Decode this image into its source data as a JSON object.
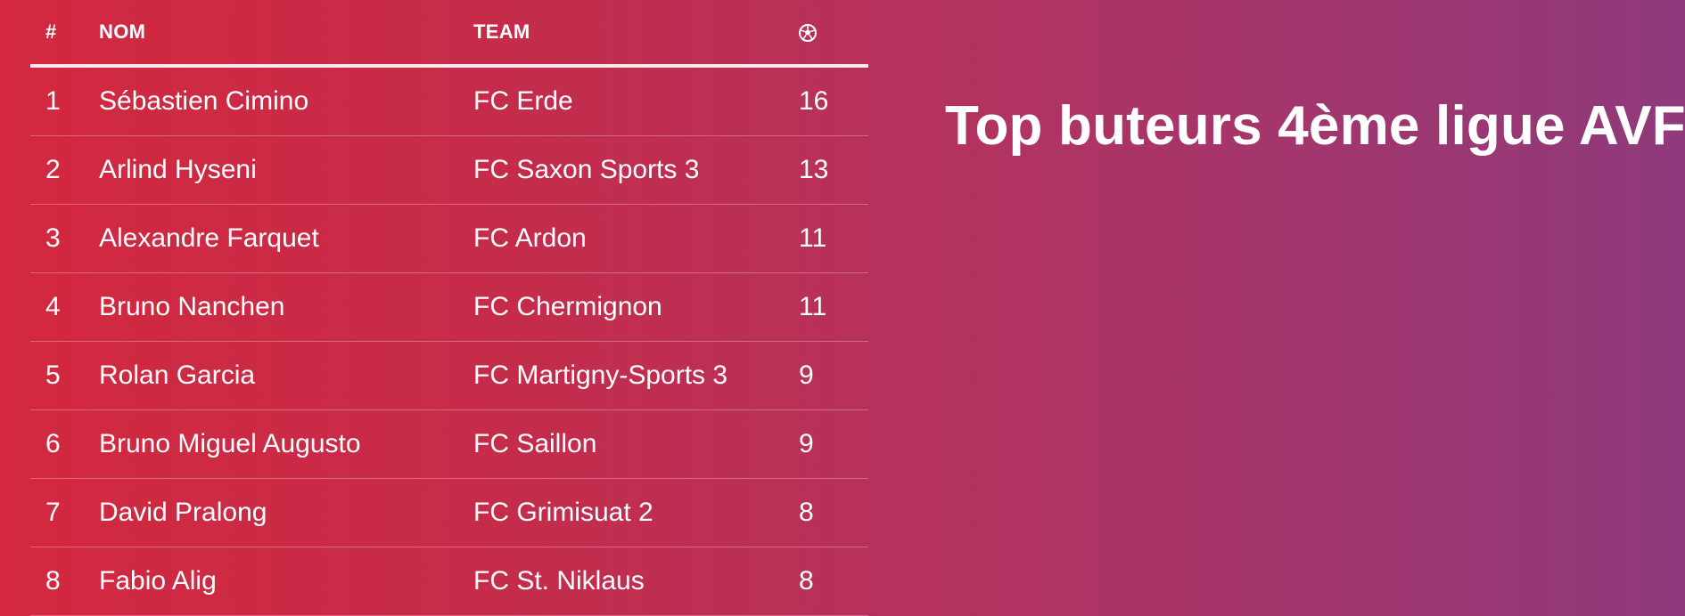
{
  "page": {
    "title": "Top buteurs 4ème ligue AVF"
  },
  "table": {
    "headers": {
      "rank": "#",
      "name": "NOM",
      "team": "TEAM",
      "goals_icon": "soccer-ball-icon"
    },
    "rows": [
      {
        "rank": "1",
        "name": "Sébastien Cimino",
        "team": "FC Erde",
        "goals": "16"
      },
      {
        "rank": "2",
        "name": "Arlind Hyseni",
        "team": "FC Saxon Sports 3",
        "goals": "13"
      },
      {
        "rank": "3",
        "name": "Alexandre Farquet",
        "team": "FC Ardon",
        "goals": "11"
      },
      {
        "rank": "4",
        "name": "Bruno Nanchen",
        "team": "FC Chermignon",
        "goals": "11"
      },
      {
        "rank": "5",
        "name": "Rolan Garcia",
        "team": "FC Martigny-Sports 3",
        "goals": "9"
      },
      {
        "rank": "6",
        "name": "Bruno Miguel Augusto",
        "team": "FC Saillon",
        "goals": "9"
      },
      {
        "rank": "7",
        "name": "David Pralong",
        "team": "FC Grimisuat 2",
        "goals": "8"
      },
      {
        "rank": "8",
        "name": "Fabio Alig",
        "team": "FC St. Niklaus",
        "goals": "8"
      }
    ]
  },
  "colors": {
    "gradient_start": "#d3283f",
    "gradient_end": "#8f3a7c",
    "text": "#ffffff"
  }
}
